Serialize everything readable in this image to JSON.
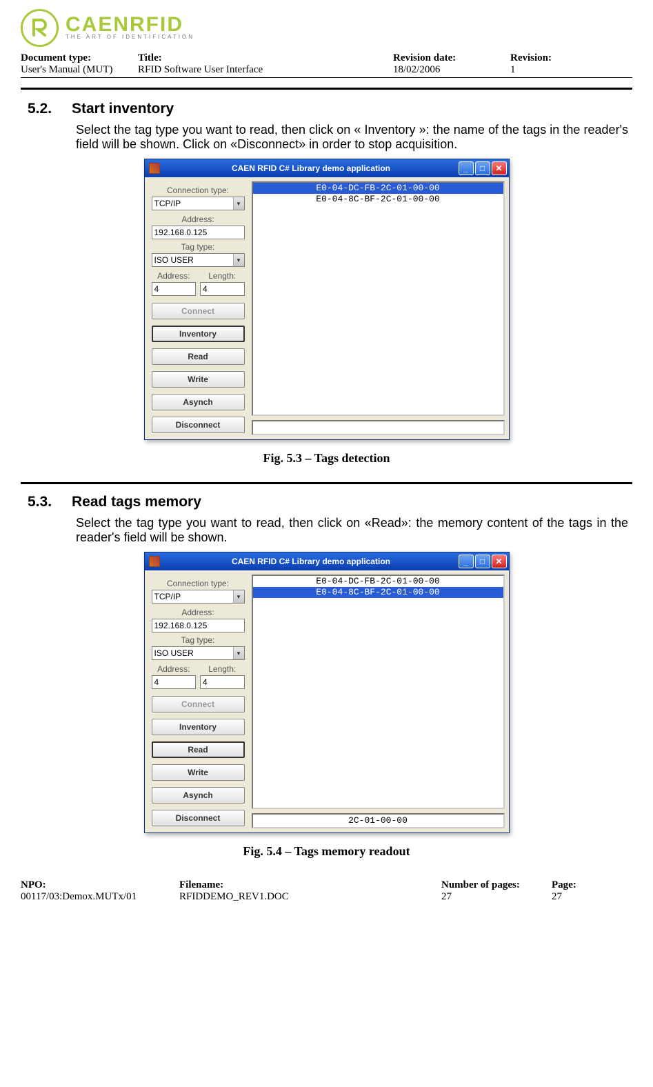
{
  "logo": {
    "brand": "CAENRFID",
    "tagline": "THE ART OF IDENTIFICATION"
  },
  "header": {
    "doctype_label": "Document type:",
    "doctype_value": "User's Manual (MUT)",
    "title_label": "Title:",
    "title_value": "RFID Software User Interface",
    "revdate_label": "Revision date:",
    "revdate_value": "18/02/2006",
    "rev_label": "Revision:",
    "rev_value": "1"
  },
  "sec52": {
    "num": "5.2.",
    "title": "Start inventory",
    "text": "Select the tag type you want to read, then click on « Inventory »: the name of the tags in the reader's field will be shown. Click on «Disconnect» in order to stop acquisition.",
    "caption": "Fig. 5.3 – Tags detection"
  },
  "sec53": {
    "num": "5.3.",
    "title": "Read tags memory",
    "text": "Select the tag type you want to read, then click on «Read»: the memory content of the tags in the reader's field will be shown.",
    "caption": "Fig. 5.4 – Tags memory readout"
  },
  "app": {
    "title": "CAEN RFID C# Library demo application",
    "labels": {
      "conn_type": "Connection type:",
      "address": "Address:",
      "tag_type": "Tag type:",
      "addr2": "Address:",
      "length": "Length:"
    },
    "values": {
      "conn_type": "TCP/IP",
      "address": "192.168.0.125",
      "tag_type": "ISO USER",
      "addr2": "4",
      "length": "4"
    },
    "buttons": {
      "connect": "Connect",
      "inventory": "Inventory",
      "read": "Read",
      "write": "Write",
      "asynch": "Asynch",
      "disconnect": "Disconnect"
    },
    "fig53": {
      "tags": [
        "E0-04-DC-FB-2C-01-00-00",
        "E0-04-8C-BF-2C-01-00-00"
      ],
      "selected": 0,
      "status": ""
    },
    "fig54": {
      "tags": [
        "E0-04-DC-FB-2C-01-00-00",
        "E0-04-8C-BF-2C-01-00-00"
      ],
      "selected": 1,
      "status": "2C-01-00-00"
    }
  },
  "footer": {
    "npo_label": "NPO:",
    "npo_value": "00117/03:Demox.MUTx/01",
    "fn_label": "Filename:",
    "fn_value": "RFIDDEMO_REV1.DOC",
    "np_label": "Number of pages:",
    "np_value": "27",
    "pg_label": "Page:",
    "pg_value": "27"
  }
}
